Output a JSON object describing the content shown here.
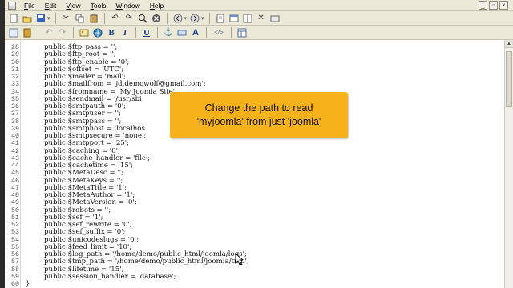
{
  "menubar": {
    "items": [
      "File",
      "Edit",
      "View",
      "Tools",
      "Window",
      "Help"
    ]
  },
  "toolbar1": {
    "icons": [
      "new-icon",
      "open-icon",
      "save-icon",
      "cut-icon",
      "copy-icon",
      "paste-icon",
      "undo-icon",
      "redo-icon",
      "find-icon",
      "stop-icon",
      "back-icon",
      "forward-icon",
      "close-icon",
      "settings-icon"
    ]
  },
  "format_bar": {
    "bold_label": "B",
    "italic_label": "I",
    "underline_label": "U",
    "font_label": "A",
    "tag_label": "</>"
  },
  "editor": {
    "line_numbers": [
      "28",
      "29",
      "30",
      "31",
      "32",
      "33",
      "34",
      "35",
      "36",
      "37",
      "38",
      "39",
      "40",
      "41",
      "42",
      "43",
      "44",
      "45",
      "46",
      "47",
      "48",
      "49",
      "50",
      "51",
      "52",
      "53",
      "54",
      "55",
      "56",
      "57",
      "58",
      "59",
      "60"
    ],
    "lines": [
      "public $ftp_pass = '';",
      "public $ftp_root = '';",
      "public $ftp_enable = '0';",
      "public $offset = 'UTC';",
      "public $mailer = 'mail';",
      "public $mailfrom = 'jd.demowolf@gmail.com';",
      "public $fromname = 'My Joomla Site';",
      "public $sendmail = '/usr/sbi",
      "public $smtpauth = '0';",
      "public $smtpuser = '';",
      "public $smtppass = '';",
      "public $smtphost = 'localhos",
      "public $smtpsecure = 'none';",
      "public $smtpport = '25';",
      "public $caching = '0';",
      "public $cache_handler = 'file';",
      "public $cachetime = '15';",
      "public $MetaDesc = '';",
      "public $MetaKeys = '';",
      "public $MetaTitle = '1';",
      "public $MetaAuthor = '1';",
      "public $MetaVersion = '0';",
      "public $robots = '';",
      "public $sef = '1';",
      "public $sef_rewrite = '0';",
      "public $sef_suffix = '0';",
      "public $unicodeslugs = '0';",
      "public $feed_limit = '10';",
      "public $log_path = '/home/demo/public_html/joomla/logs';",
      "public $tmp_path = '/home/demo/public_html/joomla/tmp';",
      "public $lifetime = '15';",
      "public $session_handler = 'database';",
      "}"
    ]
  },
  "callout": {
    "line1": "Change the path to read",
    "line2": "'myjoomla' from just 'joomla'"
  },
  "colors": {
    "callout_bg": "#f7b21b",
    "chrome_bg": "#ece9d8",
    "editor_bg": "#ffffff"
  }
}
